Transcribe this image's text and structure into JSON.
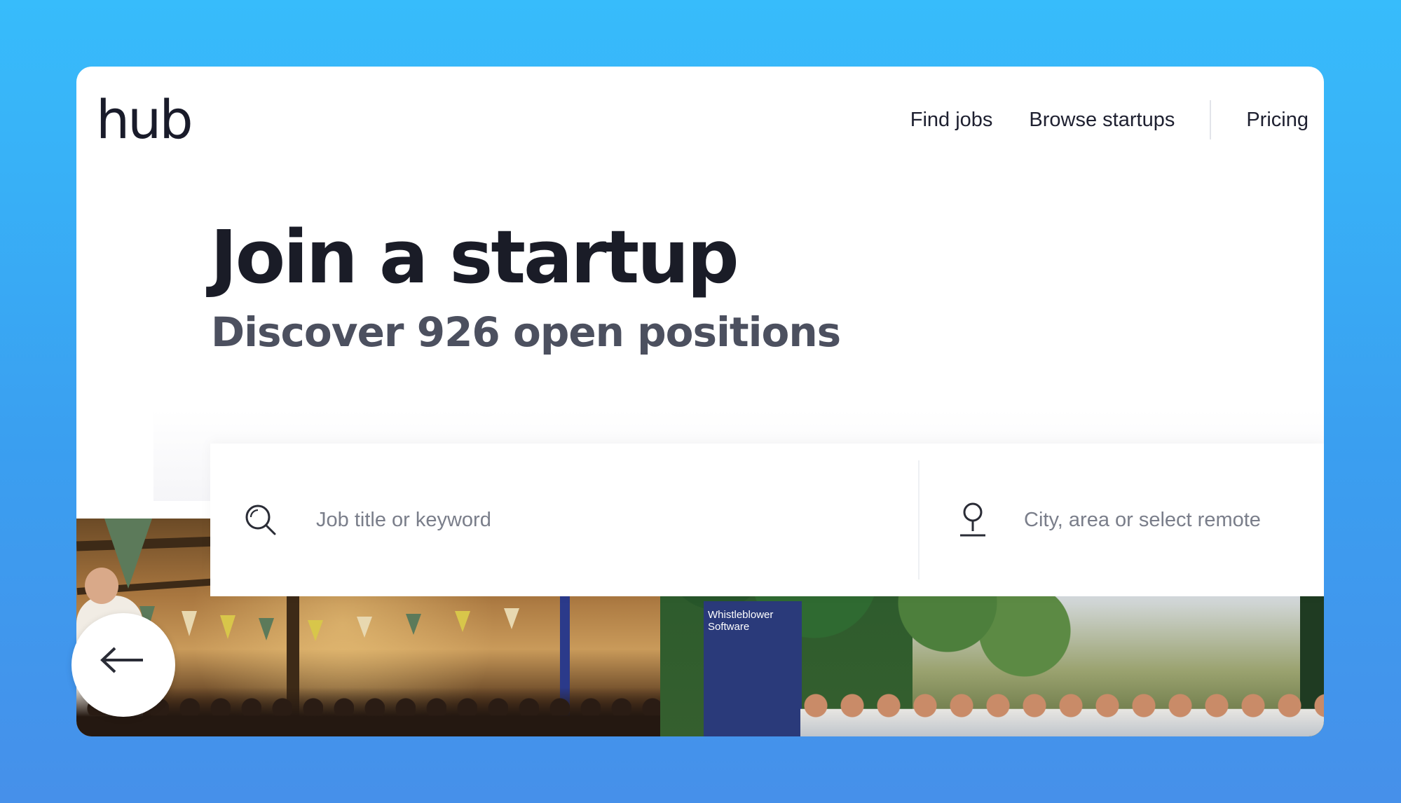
{
  "header": {
    "logo": "hub",
    "nav": {
      "find_jobs": "Find jobs",
      "browse_startups": "Browse startups",
      "pricing": "Pricing"
    }
  },
  "hero": {
    "title": "Join a startup",
    "subtitle": "Discover 926 open positions"
  },
  "search": {
    "keyword_placeholder": "Job title or keyword",
    "location_placeholder": "City, area or select remote",
    "keyword_icon": "search-icon",
    "location_icon": "map-pin-icon"
  },
  "photos": {
    "banner_text": "Whistleblower Software"
  },
  "carousel": {
    "prev_icon": "arrow-left-icon"
  },
  "colors": {
    "background_top": "#37bcfb",
    "background_bottom": "#4690ea",
    "text_dark": "#1a1c27",
    "text_muted": "#4c505f"
  }
}
